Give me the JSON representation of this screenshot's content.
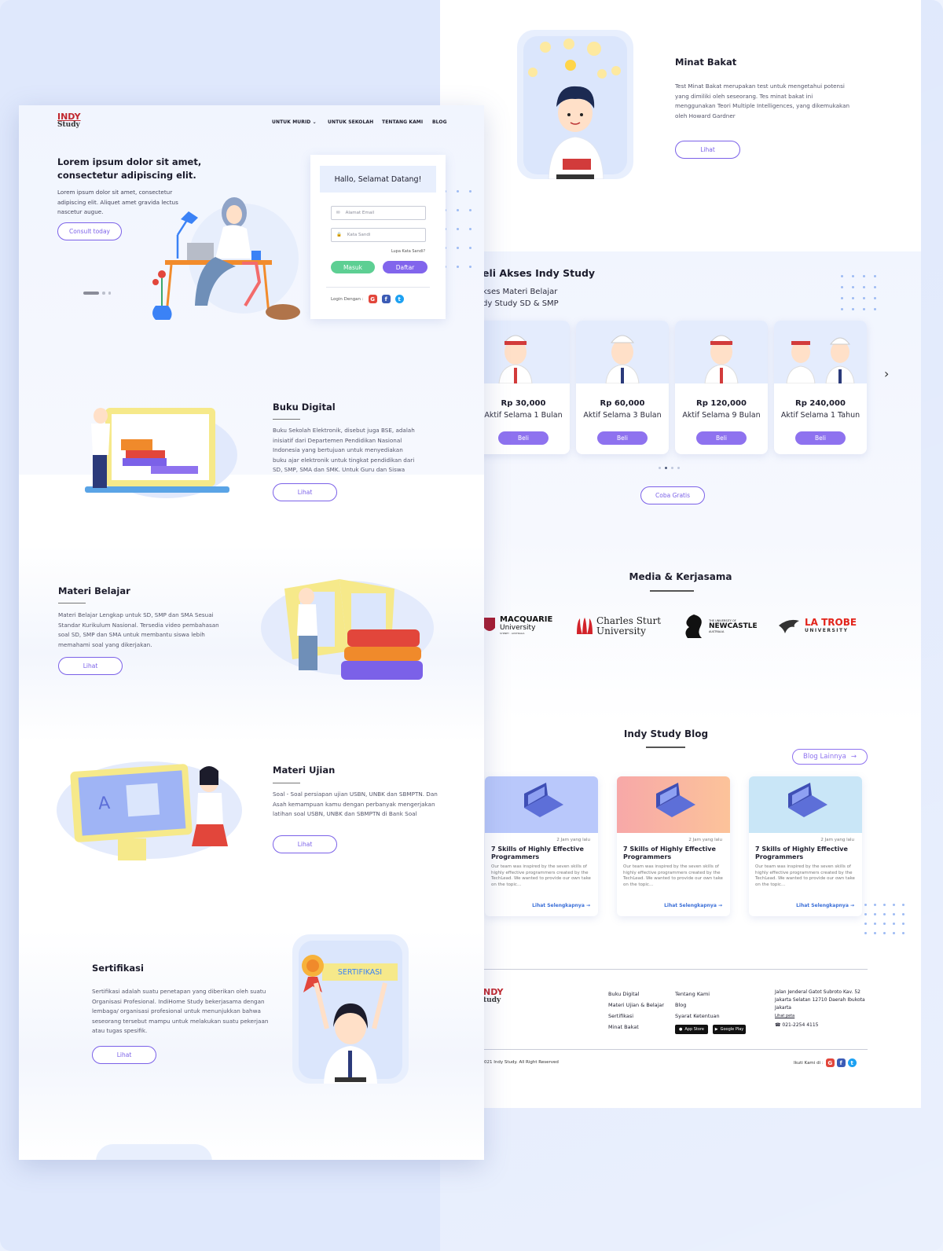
{
  "left": {
    "brand": {
      "line1": "INDY",
      "line2": "Study"
    },
    "nav": [
      {
        "label": "UNTUK MURID",
        "has_dropdown": true
      },
      {
        "label": "UNTUK SEKOLAH"
      },
      {
        "label": "TENTANG KAMI"
      },
      {
        "label": "BLOG"
      }
    ],
    "hero": {
      "title": "Lorem ipsum dolor sit amet, consectetur adipiscing elit.",
      "body": "Lorem ipsum dolor sit amet, consectetur adipiscing elit. Aliquet amet gravida lectus nascetur augue.",
      "cta": "Consult today"
    },
    "login": {
      "title": "Hallo, Selamat Datang!",
      "email_placeholder": "Alamat Email",
      "password_placeholder": "Kata Sandi",
      "forgot": "Lupa Kata Sandi?",
      "login_btn": "Masuk",
      "register_btn": "Daftar",
      "login_with": "Login Dengan :"
    },
    "features": [
      {
        "title": "Buku Digital",
        "body": "Buku Sekolah Elektronik, disebut juga BSE, adalah inisiatif dari Departemen Pendidikan Nasional Indonesia yang bertujuan untuk menyediakan buku ajar elektronik untuk tingkat pendidikan dari SD, SMP, SMA dan SMK. Untuk Guru dan Siswa",
        "btn": "Lihat"
      },
      {
        "title": "Materi Belajar",
        "body": "Materi Belajar Lengkap untuk SD, SMP dan SMA Sesuai Standar Kurikulum Nasional. Tersedia video pembahasan soal SD, SMP dan SMA untuk membantu siswa lebih memahami soal yang dikerjakan.",
        "btn": "Lihat"
      },
      {
        "title": "Materi Ujian",
        "body": "Soal - Soal persiapan ujian USBN, UNBK dan SBMPTN. Dan Asah kemampuan kamu dengan perbanyak mengerjakan latihan soal USBN, UNBK dan SBMPTN di Bank Soal",
        "btn": "Lihat"
      },
      {
        "title": "Sertifikasi",
        "body": "Sertifikasi adalah suatu penetapan yang diberikan oleh suatu Organisasi Profesional. IndiHome Study bekerjasama dengan lembaga/ organisasi profesional untuk menunjukkan bahwa seseorang tersebut mampu untuk melakukan suatu pekerjaan atau tugas spesifik.",
        "btn": "Lihat",
        "badge": "SERTIFIKASI"
      }
    ]
  },
  "right": {
    "minat": {
      "title": "Minat Bakat",
      "body": "Test Minat Bakat merupakan test untuk mengetahui potensi yang dimiliki oleh seseorang. Tes minat bakat ini menggunakan Teori Multiple Intelligences, yang dikemukakan oleh Howard Gardner",
      "btn": "Lihat"
    },
    "pricing": {
      "title": "eli Akses Indy Study",
      "sub1": "kses Materi Belajar",
      "sub2": "dy Study SD & SMP",
      "plans": [
        {
          "price": "Rp 30,000",
          "duration": "Aktif Selama 1 Bulan",
          "btn": "Beli"
        },
        {
          "price": "Rp 60,000",
          "duration": "Aktif Selama 3 Bulan",
          "btn": "Beli"
        },
        {
          "price": "Rp 120,000",
          "duration": "Aktif Selama 9 Bulan",
          "btn": "Beli"
        },
        {
          "price": "Rp 240,000",
          "duration": "Aktif Selama 1 Tahun",
          "btn": "Beli"
        }
      ],
      "trial_btn": "Coba Gratis"
    },
    "media": {
      "title": "Media & Kerjasama",
      "partners": [
        {
          "name": "MACQUARIE",
          "sub": "University",
          "tag": "SYDNEY · AUSTRALIA",
          "color": "#a6192e"
        },
        {
          "name": "Charles Sturt",
          "sub": "University",
          "color": "#d2232a"
        },
        {
          "name": "NEWCASTLE",
          "pre": "THE UNIVERSITY OF",
          "tag": "AUSTRALIA",
          "color": "#111111"
        },
        {
          "name": "LA TROBE",
          "sub": "UNIVERSITY",
          "color": "#e2231a"
        }
      ]
    },
    "blog": {
      "title": "Indy Study Blog",
      "more": "Blog Lainnya",
      "posts": [
        {
          "time": "2 Jam yang lalu",
          "title": "7 Skills of Highly Effective Programmers",
          "body": "Our team was inspired by the seven skills of highly effective programmers created by the TechLead. We wanted to provide our own take on the topic...",
          "link": "Lihat Selengkapnya"
        },
        {
          "time": "2 Jam yang lalu",
          "title": "7 Skills of Highly Effective Programmers",
          "body": "Our team was inspired by the seven skills of highly effective programmers created by the TechLead. We wanted to provide our own take on the topic...",
          "link": "Lihat Selengkapnya"
        },
        {
          "time": "2 Jam yang lalu",
          "title": "7 Skills of Highly Effective Programmers",
          "body": "Our team was inspired by the seven skills of highly effective programmers created by the TechLead. We wanted to provide our own take on the topic...",
          "link": "Lihat Selengkapnya"
        }
      ]
    },
    "footer": {
      "brand": {
        "line1": "NDY",
        "line2": "tudy"
      },
      "col1": [
        "Buku Digital",
        "Materi Ujian & Belajar",
        "Sertifikasi",
        "Minat Bakat"
      ],
      "col2": [
        "Tentang Kami",
        "Blog",
        "Syarat Ketentuan"
      ],
      "app_store": "App Store",
      "google_play": "Google Play",
      "address": "Jalan Jenderal Gatot Subroto Kav. 52 Jakarta Selatan 12710 Daerah Ibukota Jakarta",
      "map_link": "Lihat peta",
      "phone": "021-2254 4115",
      "copyright": "021 Indy Study. All Right Reserved",
      "follow": "Ikuti Kami di :"
    }
  },
  "colors": {
    "accent": "#8165ec",
    "green": "#5dcf93",
    "brand_red": "#c0262d",
    "bg": "#dfe8fc"
  }
}
